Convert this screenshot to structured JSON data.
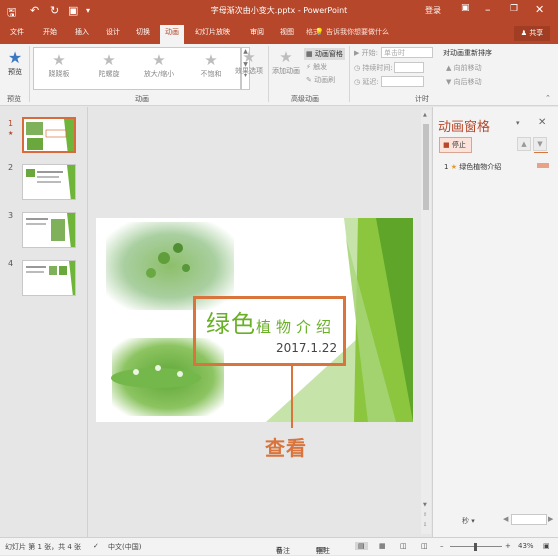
{
  "app": {
    "document_title": "字母渐次由小变大.pptx - PowerPoint",
    "login_label": "登录"
  },
  "quick_access": {
    "save_icon": "save-icon",
    "undo_icon": "undo-icon",
    "redo_icon": "redo-icon",
    "present_icon": "present-icon",
    "customize_icon": "customize-qat-icon"
  },
  "window_controls": {
    "ribbon_options_icon": "ribbon-display-options-icon",
    "minimize_icon": "minimize-icon",
    "restore_icon": "restore-icon",
    "close_icon": "close-icon"
  },
  "tabs": [
    {
      "label": "文件"
    },
    {
      "label": "开始"
    },
    {
      "label": "插入"
    },
    {
      "label": "设计"
    },
    {
      "label": "切换"
    },
    {
      "label": "动画"
    },
    {
      "label": "幻灯片放映"
    },
    {
      "label": "审阅"
    },
    {
      "label": "视图"
    },
    {
      "label": "格式"
    }
  ],
  "tell_me": "告诉我你想要做什么",
  "share_label": "共享",
  "ribbon": {
    "preview": {
      "button_label": "预览",
      "group_label": "预览"
    },
    "animation": {
      "group_label": "动画",
      "items": [
        {
          "label": "跷跷板"
        },
        {
          "label": "陀螺旋"
        },
        {
          "label": "放大/缩小"
        },
        {
          "label": "不饱和"
        }
      ],
      "effect_options_label": "效果选项"
    },
    "advanced": {
      "group_label": "高级动画",
      "add_animation_label": "添加动画",
      "animation_pane_label": "动画窗格",
      "trigger_label": "触发",
      "painter_label": "动画刷"
    },
    "timing": {
      "group_label": "计时",
      "start_label": "开始:",
      "start_value": "单击时",
      "duration_label": "持续时间:",
      "delay_label": "延迟:",
      "reorder_title": "对动画重新排序",
      "move_earlier_label": "向前移动",
      "move_later_label": "向后移动"
    }
  },
  "slide_thumbnails": [
    {
      "number": "1",
      "marker": "★"
    },
    {
      "number": "2",
      "marker": ""
    },
    {
      "number": "3",
      "marker": ""
    },
    {
      "number": "4",
      "marker": ""
    }
  ],
  "slide": {
    "title_big": "绿色",
    "title_small": "植物介绍",
    "date": "2017.1.22"
  },
  "callout_label": "查看",
  "animation_pane": {
    "title": "动画窗格",
    "stop_label": "停止",
    "items": [
      {
        "index": "1",
        "name": "绿色植物介绍"
      }
    ],
    "time_label": "秒"
  },
  "status_bar": {
    "slide_info": "幻灯片 第 1 张，共 4 张",
    "language": "中文(中国)",
    "notes_label": "备注",
    "comments_label": "批注",
    "zoom": "43%"
  },
  "colors": {
    "accent": "#b7472a",
    "callout": "#d8743c",
    "slide_green": "#69b027"
  }
}
